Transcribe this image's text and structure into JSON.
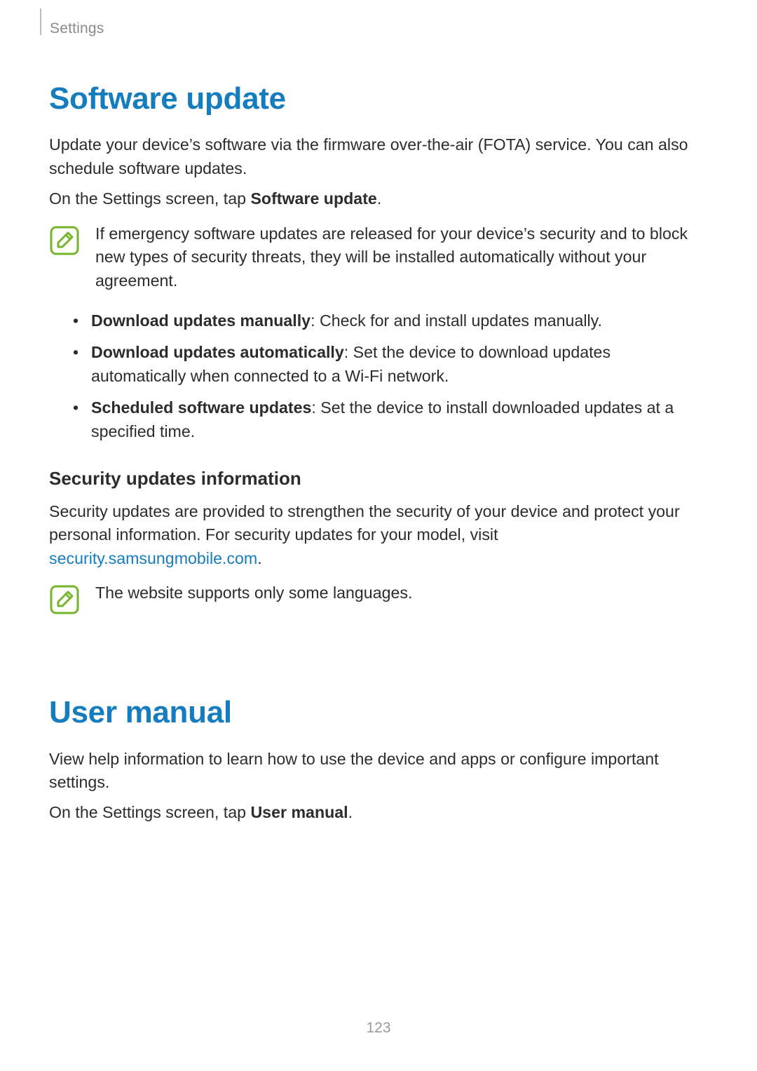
{
  "header": {
    "section": "Settings"
  },
  "software_update": {
    "title": "Software update",
    "intro": "Update your device’s software via the firmware over-the-air (FOTA) service. You can also schedule software updates.",
    "instruction_prefix": "On the Settings screen, tap ",
    "instruction_bold": "Software update",
    "instruction_suffix": ".",
    "note": "If emergency software updates are released for your device’s security and to block new types of security threats, they will be installed automatically without your agreement.",
    "bullets": [
      {
        "term": "Download updates manually",
        "desc": ": Check for and install updates manually."
      },
      {
        "term": "Download updates automatically",
        "desc": ": Set the device to download updates automatically when connected to a Wi-Fi network."
      },
      {
        "term": "Scheduled software updates",
        "desc": ": Set the device to install downloaded updates at a specified time."
      }
    ],
    "security_heading": "Security updates information",
    "security_body_prefix": "Security updates are provided to strengthen the security of your device and protect your personal information. For security updates for your model, visit ",
    "security_link_text": "security.samsungmobile.com",
    "security_body_suffix": ".",
    "security_note": "The website supports only some languages."
  },
  "user_manual": {
    "title": "User manual",
    "intro": "View help information to learn how to use the device and apps or configure important settings.",
    "instruction_prefix": "On the Settings screen, tap ",
    "instruction_bold": "User manual",
    "instruction_suffix": "."
  },
  "page_number": "123"
}
